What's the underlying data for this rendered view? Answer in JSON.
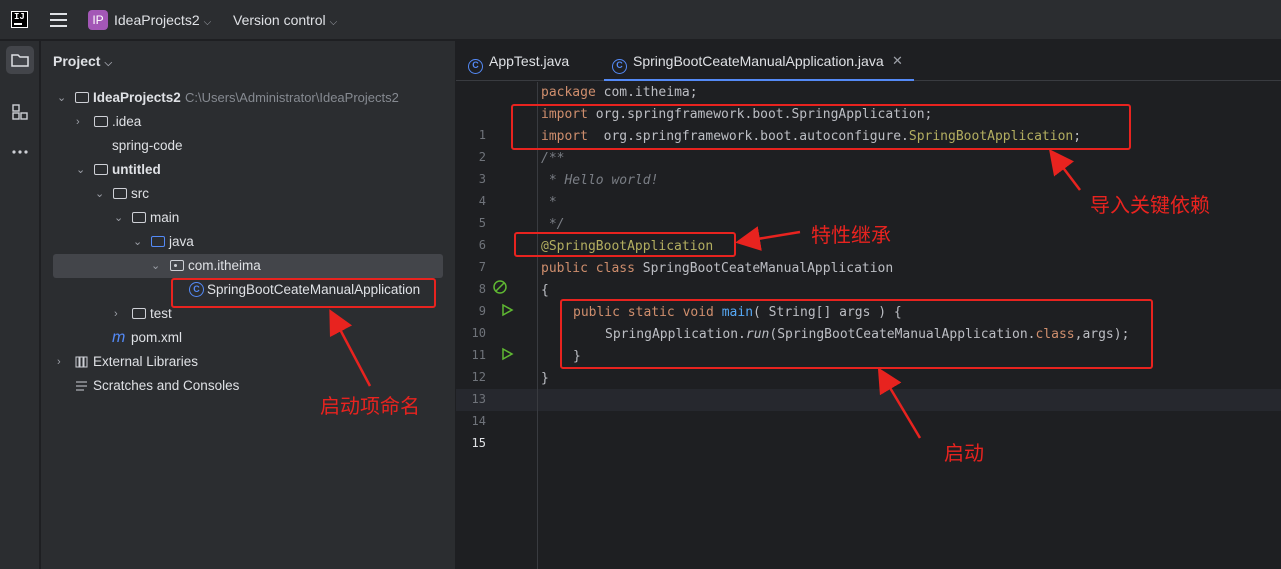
{
  "titlebar": {
    "logo_text": "IJ",
    "project_badge": "IP",
    "project_name": "IdeaProjects2",
    "vcs_label": "Version control"
  },
  "project_panel": {
    "title": "Project",
    "tree": [
      {
        "label": "IdeaProjects2",
        "path": "C:\\Users\\Administrator\\IdeaProjects2"
      },
      {
        "label": ".idea"
      },
      {
        "label": "spring-code"
      },
      {
        "label": "untitled"
      },
      {
        "label": "src"
      },
      {
        "label": "main"
      },
      {
        "label": "java"
      },
      {
        "label": "com.itheima"
      },
      {
        "label": "SpringBootCeateManualApplication"
      },
      {
        "label": "test"
      },
      {
        "label": "pom.xml",
        "icon": "m"
      },
      {
        "label": "External Libraries"
      },
      {
        "label": "Scratches and Consoles"
      }
    ]
  },
  "editor": {
    "tabs": [
      {
        "label": "AppTest.java"
      },
      {
        "label": "SpringBootCeateManualApplication.java"
      }
    ],
    "line_numbers": [
      "1",
      "2",
      "3",
      "4",
      "5",
      "6",
      "7",
      "8",
      "9",
      "10",
      "11",
      "12",
      "13",
      "14",
      "15"
    ],
    "code": {
      "l1_kw": "package",
      "l1_rest": " com.itheima;",
      "l2_kw": "import",
      "l2_rest": " org.springframework.boot.SpringApplication;",
      "l3_kw": "import",
      "l3_rest": "  org.springframework.boot.autoconfigure.",
      "l3_ann": "SpringBootApplication",
      "l3_end": ";",
      "l4": "/**",
      "l5": " * Hello world!",
      "l6": " *",
      "l7": " */",
      "l8": "@SpringBootApplication",
      "l9_kw": "public class",
      "l9_rest": " SpringBootCeateManualApplication",
      "l10": "{",
      "l11_kw": "public static void",
      "l11_fn": " main",
      "l11_rest": "( String[] args ) {",
      "l12_a": "SpringApplication.",
      "l12_run": "run",
      "l12_b": "(SpringBootCeateManualApplication.",
      "l12_kw": "class",
      "l12_c": ",args);",
      "l13": "}",
      "l14": "}"
    }
  },
  "annotations": {
    "imports_note": "导入关键依赖",
    "annotation_note": "特性继承",
    "classname_note": "启动项命名",
    "main_note": "启动"
  },
  "colors": {
    "accent": "#548af7",
    "annotation_red": "#e8231f"
  }
}
